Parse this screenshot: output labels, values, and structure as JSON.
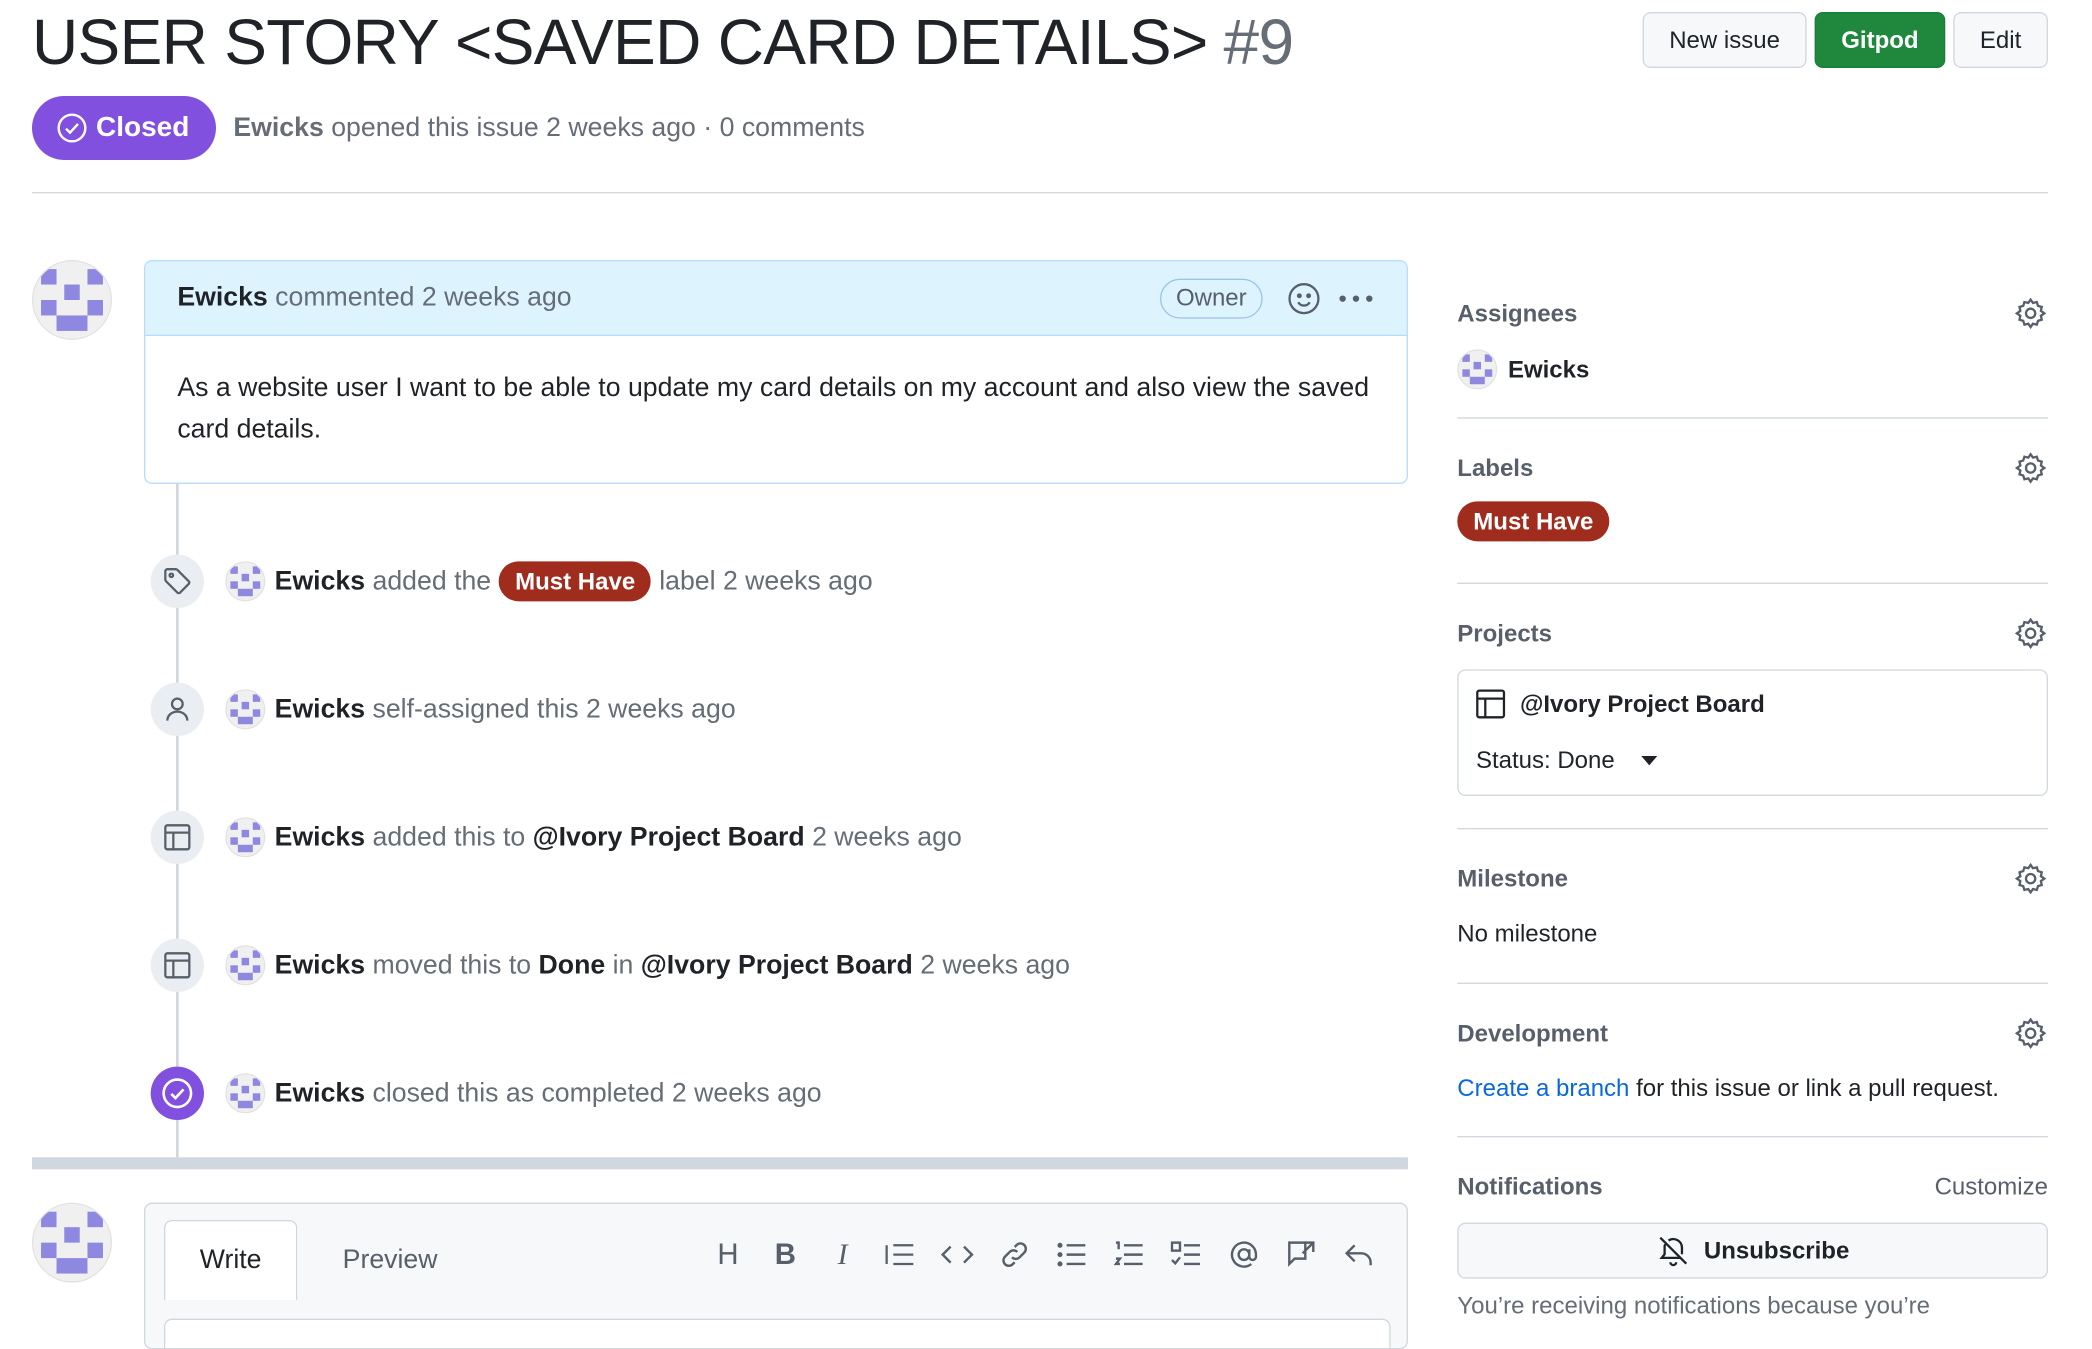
{
  "header": {
    "title": "USER STORY <SAVED CARD DETAILS>",
    "issue_number": "#9",
    "buttons": {
      "new_issue": "New issue",
      "gitpod": "Gitpod",
      "edit": "Edit"
    },
    "state": "Closed",
    "author": "Ewicks",
    "meta": "opened this issue 2 weeks ago · 0 comments"
  },
  "comment": {
    "author": "Ewicks",
    "action": "commented 2 weeks ago",
    "badge": "Owner",
    "body": "As a website user I want to be able to update my card details on my account and also view the saved card details."
  },
  "timeline": {
    "label_event": {
      "actor": "Ewicks",
      "pre": "added the",
      "label": "Must Have",
      "post": "label 2 weeks ago"
    },
    "assign_event": {
      "actor": "Ewicks",
      "text": "self-assigned this 2 weeks ago"
    },
    "project_event": {
      "actor": "Ewicks",
      "pre": "added this to",
      "project": "@Ivory Project Board",
      "post": "2 weeks ago"
    },
    "move_event": {
      "actor": "Ewicks",
      "pre": "moved this to",
      "status": "Done",
      "mid": "in",
      "project": "@Ivory Project Board",
      "post": "2 weeks ago"
    },
    "close_event": {
      "actor": "Ewicks",
      "text": "closed this as completed 2 weeks ago"
    }
  },
  "new_comment": {
    "tabs": {
      "write": "Write",
      "preview": "Preview"
    },
    "toolbar": {
      "heading": "H",
      "bold": "B",
      "italic": "I"
    }
  },
  "sidebar": {
    "assignees": {
      "title": "Assignees",
      "user": "Ewicks"
    },
    "labels": {
      "title": "Labels",
      "label": "Must Have"
    },
    "projects": {
      "title": "Projects",
      "project": "@Ivory Project Board",
      "status": "Status: Done"
    },
    "milestone": {
      "title": "Milestone",
      "value": "No milestone"
    },
    "development": {
      "title": "Development",
      "link": "Create a branch",
      "rest": "for this issue or link a pull request."
    },
    "notifications": {
      "title": "Notifications",
      "customize": "Customize",
      "button": "Unsubscribe",
      "reason": "You’re receiving notifications because you’re"
    }
  },
  "colors": {
    "closed": "#8250df",
    "label": "#a02c1e",
    "green": "#1f883d",
    "link": "#0969da",
    "comment_header": "#ddf4ff"
  },
  "icons": [
    "check-circle-icon",
    "smiley-icon",
    "kebab-icon",
    "tag-icon",
    "person-icon",
    "table-icon",
    "gear-icon",
    "bell-slash-icon",
    "triangle-down-icon"
  ]
}
